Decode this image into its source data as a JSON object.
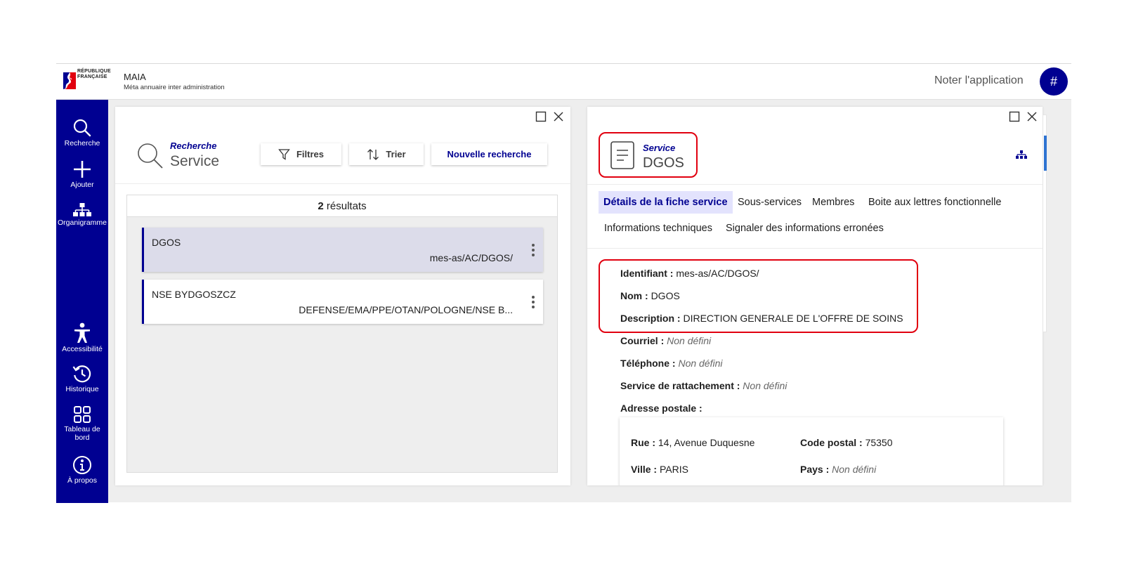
{
  "header": {
    "logo_text": "RÉPUBLIQUE\nFRANÇAISE",
    "app_name": "MAIA",
    "app_subtitle": "Méta annuaire inter administration",
    "rate_label": "Noter l'application",
    "avatar_label": "#"
  },
  "sidebar": {
    "items": [
      {
        "label": "Recherche",
        "icon": "search-icon"
      },
      {
        "label": "Ajouter",
        "icon": "plus-icon"
      },
      {
        "label": "Organigramme",
        "icon": "org-chart-icon"
      },
      {
        "label": "Accessibilité",
        "icon": "accessibility-icon"
      },
      {
        "label": "Historique",
        "icon": "history-icon"
      },
      {
        "label": "Tableau de bord",
        "icon": "dashboard-icon"
      },
      {
        "label": "À propos",
        "icon": "info-icon"
      }
    ]
  },
  "search_panel": {
    "kicker": "Recherche",
    "title": "Service",
    "filters_label": "Filtres",
    "sort_label": "Trier",
    "new_search_label": "Nouvelle recherche",
    "results_count": "2",
    "results_word": "résultats",
    "results": [
      {
        "name": "DGOS",
        "path": "mes-as/AC/DGOS/",
        "selected": true
      },
      {
        "name": "NSE BYDGOSZCZ",
        "path": "DEFENSE/EMA/PPE/OTAN/POLOGNE/NSE B...",
        "selected": false
      }
    ]
  },
  "detail_panel": {
    "kicker": "Service",
    "title": "DGOS",
    "tabs": [
      "Détails de la fiche service",
      "Sous-services",
      "Membres",
      "Boite aux lettres fonctionnelle",
      "Informations techniques",
      "Signaler des informations erronées"
    ],
    "fields": {
      "identifiant_label": "Identifiant :",
      "identifiant_value": "mes-as/AC/DGOS/",
      "nom_label": "Nom :",
      "nom_value": "DGOS",
      "description_label": "Description :",
      "description_value": "DIRECTION GENERALE DE L'OFFRE DE SOINS",
      "courriel_label": "Courriel :",
      "courriel_value": "Non défini",
      "telephone_label": "Téléphone :",
      "telephone_value": "Non défini",
      "rattachement_label": "Service de rattachement :",
      "rattachement_value": "Non défini",
      "adresse_label": "Adresse postale :"
    },
    "address": {
      "rue_label": "Rue :",
      "rue_value": "14, Avenue Duquesne",
      "cp_label": "Code postal :",
      "cp_value": "75350",
      "ville_label": "Ville :",
      "ville_value": "PARIS",
      "pays_label": "Pays :",
      "pays_value": "Non défini"
    }
  },
  "colors": {
    "brand": "#000091",
    "highlight": "#e1000f",
    "selected_row": "#dcdcea"
  }
}
